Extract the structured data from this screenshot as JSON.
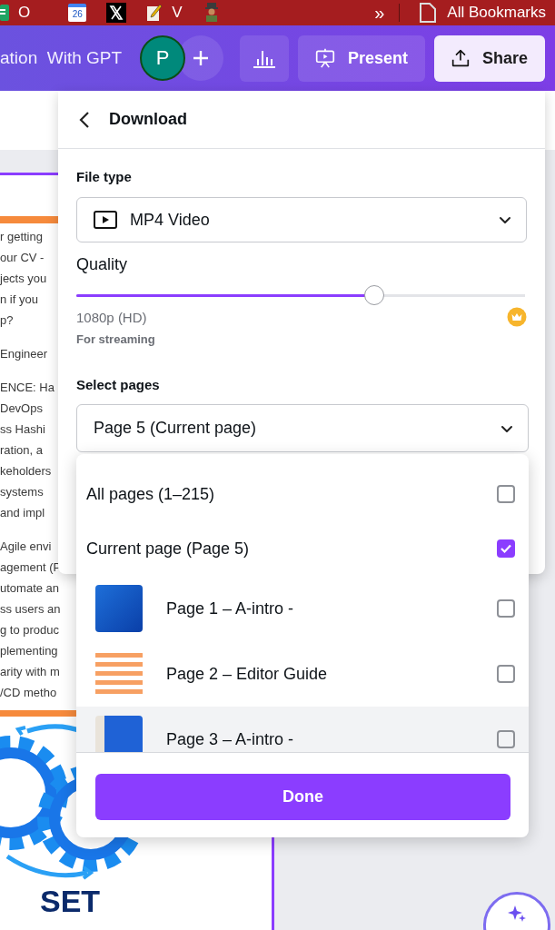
{
  "bookmarks_bar": {
    "items": [
      {
        "kind": "sheets",
        "label": "O"
      },
      {
        "kind": "calendar",
        "label": "26"
      },
      {
        "kind": "x"
      },
      {
        "kind": "notes",
        "label": "V"
      },
      {
        "kind": "figure"
      }
    ],
    "overflow": "»",
    "folder": "All Bookmarks"
  },
  "top_bar": {
    "title": "ation  With GPT",
    "avatar": "P",
    "present": "Present",
    "share": "Share"
  },
  "document": {
    "paragraphs": [
      [
        "r getting",
        "our CV -",
        "jects you",
        "n if you",
        "p?"
      ],
      [
        "Engineer"
      ],
      [
        "ENCE: Ha",
        "DevOps",
        "ss Hashi",
        "ration, a",
        "keholders",
        "systems",
        "and impl"
      ],
      [
        "Agile envi",
        "agement (P",
        "utomate an",
        "ss users an",
        "g to produc",
        "plementing",
        "arity with m",
        "/CD metho"
      ]
    ],
    "heading": "SET"
  },
  "download_panel": {
    "title": "Download",
    "file_type_label": "File type",
    "file_type": "MP4 Video",
    "quality_label": "Quality",
    "quality": {
      "level": 0.664
    },
    "quality_value": "1080p (HD)",
    "quality_note": "For streaming",
    "pages_label": "Select pages",
    "pages_value": "Page 5 (Current page)"
  },
  "pages_menu": {
    "options": [
      {
        "label": "All pages (1–215)",
        "checked": false
      },
      {
        "label": "Current page (Page 5)",
        "checked": true
      }
    ],
    "pages": [
      {
        "label": "Page 1 – A-intro -",
        "kind": "cover",
        "checked": false,
        "highlighted": false
      },
      {
        "label": "Page 2 – Editor Guide",
        "kind": "guide",
        "checked": false,
        "highlighted": false
      },
      {
        "label": "Page 3 – A-intro -",
        "kind": "title",
        "checked": false,
        "highlighted": true
      }
    ],
    "done": "Done"
  }
}
